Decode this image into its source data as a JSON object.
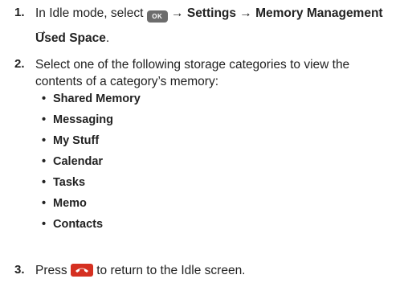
{
  "steps": [
    {
      "number": "1.",
      "line1_pre": "In Idle mode, select",
      "ok_key_label": "OK",
      "path": "→ Settings → Memory Management →",
      "line2_bold": "Used Space",
      "line2_tail": "."
    },
    {
      "number": "2.",
      "text": "Select one of the following storage categories to view the contents of a category’s memory:"
    },
    {
      "number": "3.",
      "pre": "Press",
      "post": "to return to the Idle screen."
    }
  ],
  "categories": [
    "Shared Memory",
    "Messaging",
    "My Stuff",
    "Calendar",
    "Tasks",
    "Memo",
    "Contacts"
  ],
  "bullet_char": "•",
  "icons": {
    "ok_key": "ok-key-icon",
    "end_key": "end-call-key-icon"
  },
  "colors": {
    "end_key": "#d53021",
    "ok_key": "#6c6c6c"
  }
}
